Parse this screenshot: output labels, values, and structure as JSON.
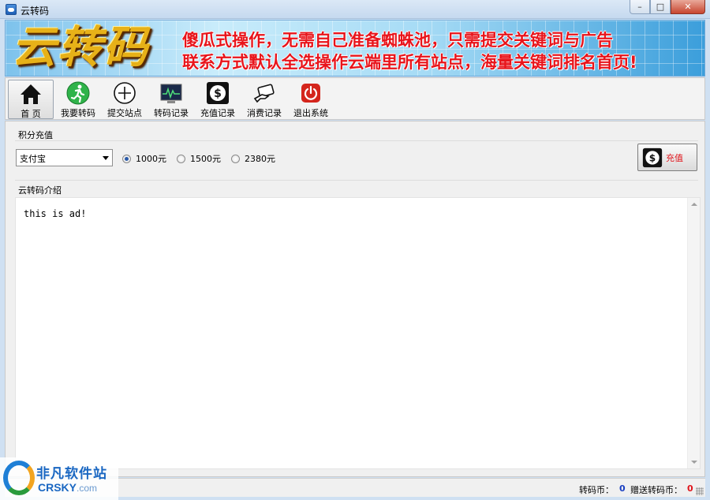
{
  "window": {
    "title": "云转码",
    "min": "–",
    "max": "□",
    "close": "✕"
  },
  "banner": {
    "logo": "云转码",
    "line1": "傻瓜式操作，无需自己准备蜘蛛池，只需提交关键词与广告",
    "line2": "联系方式默认全选操作云端里所有站点，海量关键词排名首页!"
  },
  "toolbar": {
    "items": [
      {
        "label": "首 页",
        "icon": "home-icon",
        "active": true
      },
      {
        "label": "我要转码",
        "icon": "running-man-icon"
      },
      {
        "label": "提交站点",
        "icon": "plus-circle-icon"
      },
      {
        "label": "转码记录",
        "icon": "monitor-chart-icon"
      },
      {
        "label": "充值记录",
        "icon": "dollar-icon"
      },
      {
        "label": "消费记录",
        "icon": "hand-card-icon"
      },
      {
        "label": "退出系统",
        "icon": "power-icon"
      }
    ]
  },
  "recharge": {
    "section_title": "积分充值",
    "payment_method": "支付宝",
    "options": [
      {
        "label": "1000元",
        "checked": true
      },
      {
        "label": "1500元",
        "checked": false
      },
      {
        "label": "2380元",
        "checked": false
      }
    ],
    "button_label": "充值"
  },
  "intro": {
    "section_title": "云转码介绍",
    "content": "this is ad!"
  },
  "status": {
    "coins_label": "转码币：",
    "coins_value": "0",
    "gift_label": "赠送转码币：",
    "gift_value": "0"
  },
  "watermark": {
    "cn": "非凡软件站",
    "en": "CRSKY",
    "en_suffix": ".com"
  },
  "colors": {
    "accent_red": "#e0141b",
    "coin_blue": "#1a3fc2",
    "gift_red": "#e0141b"
  }
}
